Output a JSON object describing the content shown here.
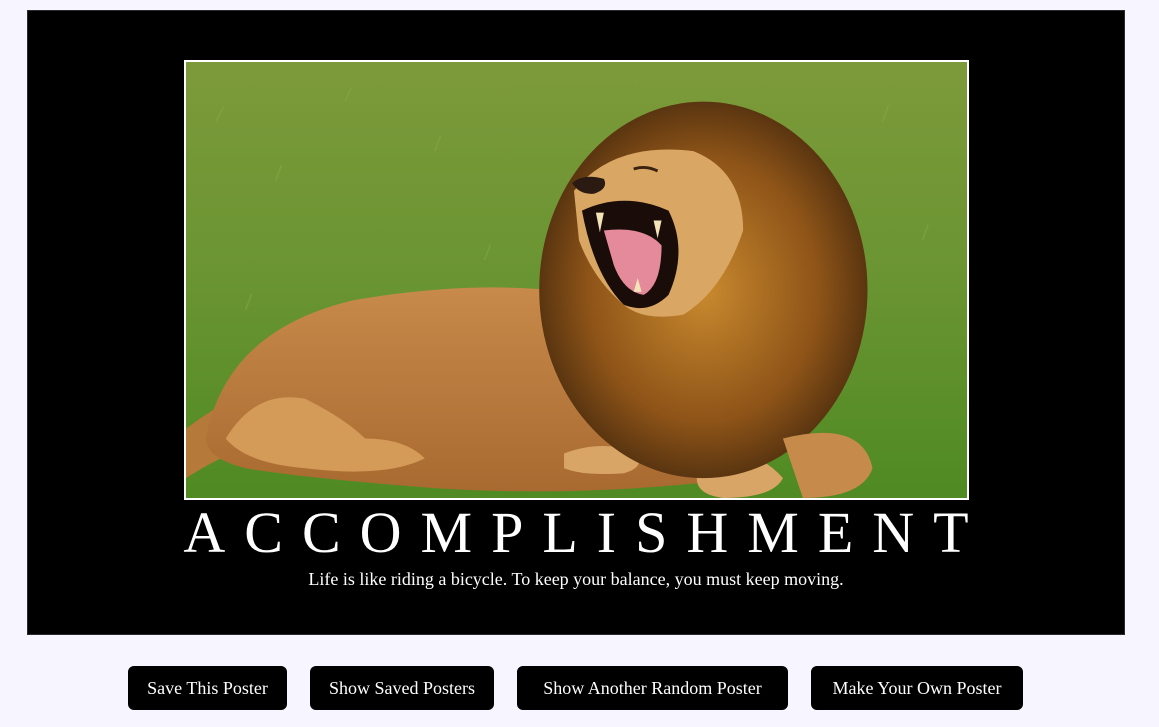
{
  "poster": {
    "image_description": "lion",
    "title": "ACCOMPLISHMENT",
    "quote": "Life is like riding a bicycle. To keep your balance, you must keep moving."
  },
  "buttons": {
    "save": "Save This Poster",
    "show_saved": "Show Saved Posters",
    "random": "Show Another Random Poster",
    "make_own": "Make Your Own Poster"
  },
  "colors": {
    "page_background": "#f7f5ff",
    "poster_background": "#000000",
    "button_background": "#000000",
    "text": "#ffffff"
  }
}
